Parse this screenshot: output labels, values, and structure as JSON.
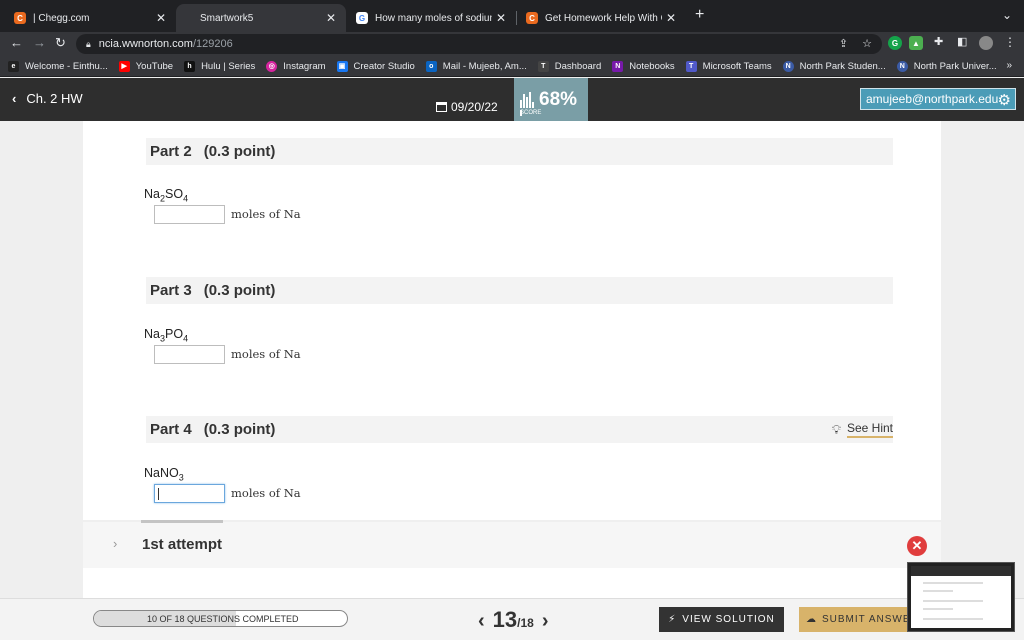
{
  "browser": {
    "tabs": [
      {
        "label": "| Chegg.com",
        "favicon": "chegg-icon",
        "active": false
      },
      {
        "label": "Smartwork5",
        "favicon": "",
        "active": true
      },
      {
        "label": "How many moles of sodium ar",
        "favicon": "google-icon",
        "active": false
      },
      {
        "label": "Get Homework Help With Che",
        "favicon": "chegg-icon",
        "active": false
      }
    ],
    "new_tab": "+",
    "url_host": "ncia.wwnorton.com",
    "url_path": "/129206",
    "bookmarks": [
      {
        "label": "Welcome - Einthu...",
        "icon": "einthusan-icon",
        "color": "#222222"
      },
      {
        "label": "YouTube",
        "icon": "youtube-icon",
        "color": "#ff0000"
      },
      {
        "label": "Hulu | Series",
        "icon": "hulu-icon",
        "color": "#111111"
      },
      {
        "label": "Instagram",
        "icon": "instagram-icon",
        "color": "#d6249f"
      },
      {
        "label": "Creator Studio",
        "icon": "creator-studio-icon",
        "color": "#1877f2"
      },
      {
        "label": "Mail - Mujeeb, Am...",
        "icon": "outlook-icon",
        "color": "#0a64c2"
      },
      {
        "label": "Dashboard",
        "icon": "dashboard-icon",
        "color": "#444444"
      },
      {
        "label": "Notebooks",
        "icon": "onenote-icon",
        "color": "#7719aa"
      },
      {
        "label": "Microsoft Teams",
        "icon": "teams-icon",
        "color": "#5059c9"
      },
      {
        "label": "North Park Studen...",
        "icon": "northpark-icon",
        "color": "#3b5ba5"
      },
      {
        "label": "North Park Univer...",
        "icon": "northpark-icon",
        "color": "#3b5ba5"
      }
    ],
    "bookmarks_more": "»"
  },
  "header": {
    "back_label": "Ch. 2 HW",
    "date": "09/20/22",
    "score_label": "SCORE",
    "score": "68%",
    "user": "amujeeb@northpark.edu"
  },
  "parts": [
    {
      "title": "Part 2",
      "points": "(0.3 point)",
      "formula_pre": "Na",
      "formula_sub1": "2",
      "formula_mid": "SO",
      "formula_sub2": "4",
      "units": "moles of Na",
      "value": ""
    },
    {
      "title": "Part 3",
      "points": "(0.3 point)",
      "formula_pre": "Na",
      "formula_sub1": "3",
      "formula_mid": "PO",
      "formula_sub2": "4",
      "units": "moles of Na",
      "value": ""
    },
    {
      "title": "Part 4",
      "points": "(0.3 point)",
      "formula_pre": "NaNO",
      "formula_sub1": "3",
      "formula_mid": "",
      "formula_sub2": "",
      "units": "moles of Na",
      "value": "",
      "hint": "See Hint"
    }
  ],
  "attempt": {
    "label": "1st attempt"
  },
  "footer": {
    "progress_text": "10 OF 18 QUESTIONS COMPLETED",
    "progress_fraction": 0.56,
    "current": "13",
    "total": "/18",
    "view_solution": "VIEW SOLUTION",
    "submit": "SUBMIT ANSWER"
  },
  "colors": {
    "accent": "#4b9cb7",
    "score_bg": "#7a9ea6",
    "submit_bg": "#d8b36a",
    "error": "#e03d3d"
  }
}
